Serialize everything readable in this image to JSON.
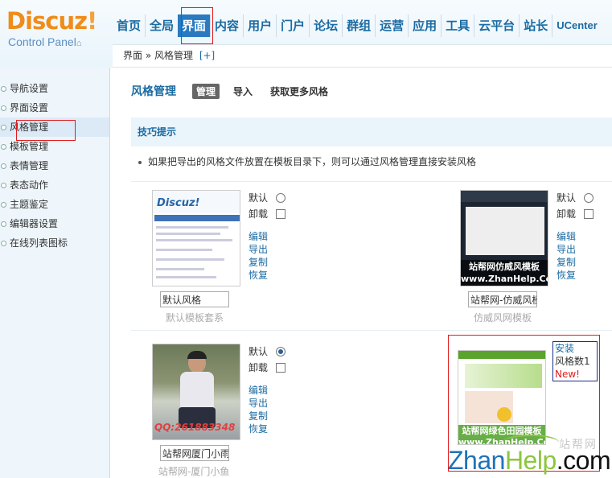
{
  "logo": {
    "main": "Discuz",
    "bang": "!",
    "sub": "Control Panel"
  },
  "topnav": {
    "items": [
      "首页",
      "全局",
      "界面",
      "内容",
      "用户",
      "门户",
      "论坛",
      "群组",
      "运营",
      "应用",
      "工具",
      "云平台",
      "站长",
      "UCenter"
    ],
    "active": "界面"
  },
  "breadcrumb": {
    "path": "界面 » 风格管理",
    "plus": "[+]"
  },
  "sidebar": {
    "items": [
      "导航设置",
      "界面设置",
      "风格管理",
      "模板管理",
      "表情管理",
      "表态动作",
      "主题鉴定",
      "编辑器设置",
      "在线列表图标"
    ],
    "active": "风格管理"
  },
  "main": {
    "title": "风格管理",
    "tabs": [
      "管理",
      "导入",
      "获取更多风格"
    ],
    "active_tab": "管理",
    "tips_title": "技巧提示",
    "tip_text": "如果把导出的风格文件放置在模板目录下，则可以通过风格管理直接安装风格"
  },
  "labels": {
    "default": "默认",
    "uninstall": "卸载",
    "edit": "编辑",
    "export": "导出",
    "copy": "复制",
    "restore": "恢复"
  },
  "styles": [
    {
      "name": "默认风格",
      "caption": "默认模板套系",
      "thumb_text": "Discuz!",
      "default_checked": false
    },
    {
      "name": "站帮网-仿威风模",
      "caption": "仿威风网模板",
      "thumb_text": "站帮网仿威风模板",
      "thumb_text2": "www.ZhanHelp.Com",
      "default_checked": false
    },
    {
      "name": "站帮网厦门小雨",
      "caption": "站帮网-厦门小鱼",
      "thumb_text": "QQ:261883348",
      "default_checked": true
    }
  ],
  "uninstalled": {
    "thumb_text": "站帮网绿色田园模板",
    "thumb_text2": "www.ZhanHelp.Com",
    "install": "安装",
    "count": "风格数1",
    "new": "New!"
  },
  "watermark": {
    "cn": "站帮网",
    "z": "Zhan",
    "h": "Help",
    "c": ".com"
  }
}
